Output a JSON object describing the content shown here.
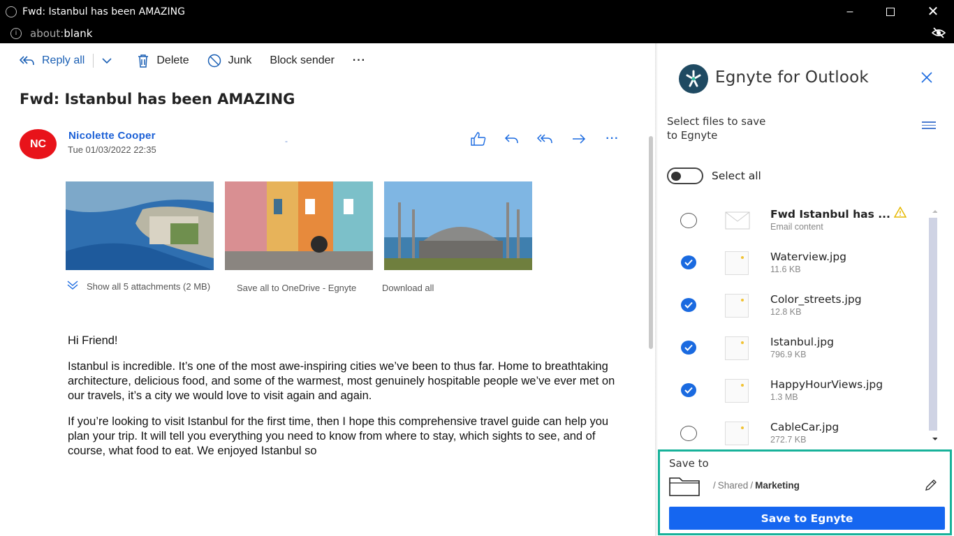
{
  "window": {
    "title": "Fwd: Istanbul has been AMAZING",
    "url_prefix": "about:",
    "url_main": "blank"
  },
  "toolbar": {
    "reply_all": "Reply all",
    "delete": "Delete",
    "junk": "Junk",
    "block_sender": "Block sender",
    "more": "···"
  },
  "message": {
    "subject": "Fwd: Istanbul has been AMAZING",
    "avatar_initials": "NC",
    "avatar_color": "#e8131a",
    "sender": "Nicolette Cooper",
    "date": "Tue 01/03/2022 22:35",
    "dash": "-"
  },
  "attachments": {
    "show_all": "Show all 5 attachments (2 MB)",
    "save_all": "Save all to OneDrive - Egnyte",
    "download_all": "Download all"
  },
  "body": {
    "greeting": "Hi Friend!",
    "para1": "Istanbul is incredible. It’s one of the most awe-inspiring cities we’ve been to thus far. Home to breathtaking architecture, delicious food, and some of the warmest, most genuinely hospitable people we’ve ever met on our travels, it’s a city we would love to visit again and again.",
    "para2": "If you’re looking to visit Istanbul for the first time, then I hope this comprehensive travel guide can help you plan your trip. It will tell you everything you need to know from where to stay, which sights to see, and of course, what food to eat. We enjoyed Istanbul so"
  },
  "egnyte": {
    "title": "Egnyte for Outlook",
    "instruction_line1": "Select files to save",
    "instruction_line2": "to Egnyte",
    "select_all": "Select all",
    "files": [
      {
        "name": "Fwd Istanbul has ...",
        "size": "Email content",
        "checked": false
      },
      {
        "name": "Waterview.jpg",
        "size": "11.6 KB",
        "checked": true
      },
      {
        "name": "Color_streets.jpg",
        "size": "12.8 KB",
        "checked": true
      },
      {
        "name": "Istanbul.jpg",
        "size": "796.9 KB",
        "checked": true
      },
      {
        "name": "HappyHourViews.jpg",
        "size": "1.3 MB",
        "checked": true
      },
      {
        "name": "CableCar.jpg",
        "size": "272.7 KB",
        "checked": false
      }
    ],
    "save_to_label": "Save to",
    "path_root": "Shared",
    "path_leaf": "Marketing",
    "path_sep": "/",
    "save_button": "Save to Egnyte",
    "accent": "#1566f0",
    "highlight": "#17b29a"
  }
}
